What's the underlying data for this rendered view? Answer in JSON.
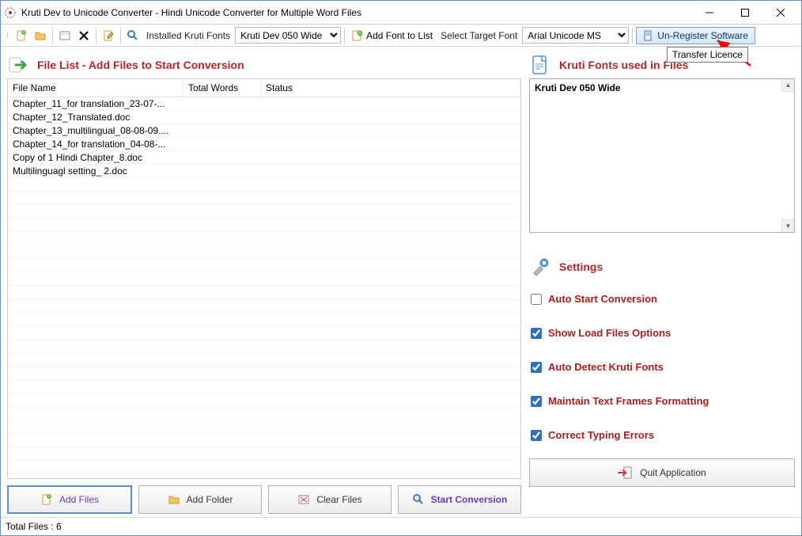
{
  "window": {
    "title": "Kruti Dev to Unicode Converter - Hindi Unicode Converter for Multiple Word Files"
  },
  "toolbar": {
    "installed_label": "Installed Kruti Fonts",
    "kruti_font_selected": "Kruti Dev 050 Wide",
    "add_font_label": "Add Font to List",
    "select_target_label": "Select Target Font",
    "target_font_selected": "Arial Unicode MS",
    "unregister_label": "Un-Register Software"
  },
  "tooltip": "Transfer Licence",
  "file_list": {
    "header": "File List - Add Files to Start Conversion",
    "columns": {
      "fname": "File Name",
      "twords": "Total Words",
      "status": "Status"
    },
    "rows": [
      {
        "fname": "Chapter_11_for translation_23-07-..."
      },
      {
        "fname": "Chapter_12_Translated.doc"
      },
      {
        "fname": "Chapter_13_multilingual_08-08-09...."
      },
      {
        "fname": "Chapter_14_for translation_04-08-..."
      },
      {
        "fname": "Copy of 1 Hindi Chapter_8.doc"
      },
      {
        "fname": "Multilinguagl setting_ 2.doc"
      }
    ]
  },
  "buttons": {
    "add_files": "Add Files",
    "add_folder": "Add Folder",
    "clear_files": "Clear Files",
    "start": "Start Conversion",
    "quit": "Quit Application"
  },
  "kruti_fonts": {
    "header": "Kruti Fonts used in Files",
    "items": [
      "Kruti Dev 050 Wide"
    ]
  },
  "settings": {
    "header": "Settings",
    "options": [
      {
        "label": "Auto Start Conversion",
        "checked": false
      },
      {
        "label": "Show Load Files Options",
        "checked": true
      },
      {
        "label": "Auto Detect Kruti Fonts",
        "checked": true
      },
      {
        "label": "Maintain Text Frames Formatting",
        "checked": true
      },
      {
        "label": "Correct Typing Errors",
        "checked": true
      }
    ]
  },
  "statusbar": "Total Files :  6"
}
